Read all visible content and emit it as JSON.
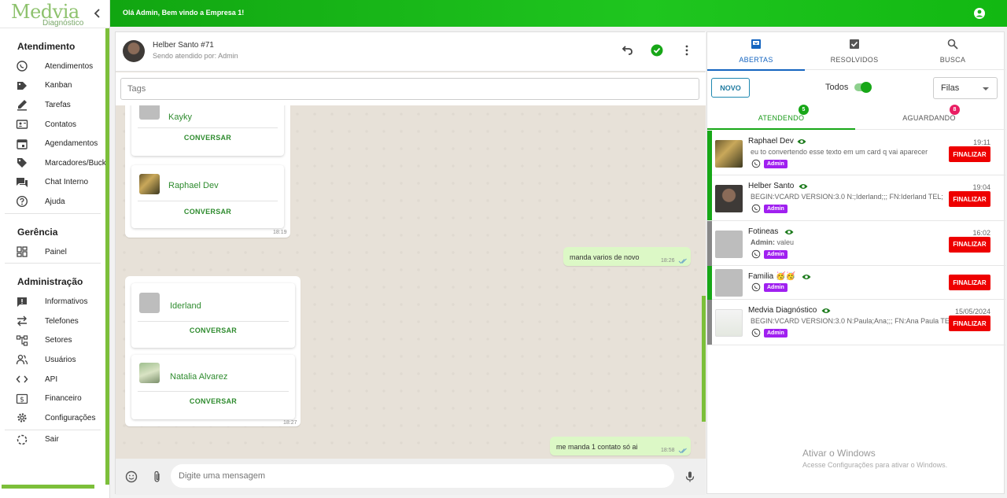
{
  "sidebar": {
    "logo_brand": "Medvia",
    "logo_sub": "Diagnóstico",
    "sections": {
      "atendimento": "Atendimento",
      "gerencia": "Gerência",
      "administracao": "Administração"
    },
    "items": {
      "atendimentos": "Atendimentos",
      "kanban": "Kanban",
      "tarefas": "Tarefas",
      "contatos": "Contatos",
      "agendamentos": "Agendamentos",
      "marcadores": "Marcadores/Bucket",
      "chat_interno": "Chat Interno",
      "ajuda": "Ajuda",
      "painel": "Painel",
      "informativos": "Informativos",
      "telefones": "Telefones",
      "setores": "Setores",
      "usuarios": "Usuários",
      "api": "API",
      "financeiro": "Financeiro",
      "configuracoes": "Configurações",
      "sair": "Sair"
    }
  },
  "topbar": {
    "greeting": "Olá Admin, Bem vindo a Empresa 1!"
  },
  "chat": {
    "title": "Helber Santo #71",
    "subtitle": "Sendo atendido por: Admin",
    "tags_placeholder": "Tags",
    "composer_placeholder": "Digite uma mensagem",
    "cards": {
      "kayky": {
        "name": "Kayky",
        "button": "CONVERSAR"
      },
      "raphael": {
        "name": "Raphael Dev",
        "button": "CONVERSAR"
      },
      "iderland": {
        "name": "Iderland",
        "button": "CONVERSAR"
      },
      "natalia": {
        "name": "Natalia Alvarez",
        "button": "CONVERSAR"
      }
    },
    "times": {
      "group1": "18:19",
      "out1": "18:26",
      "group2": "18:27",
      "out2": "18:58"
    },
    "outgoing": {
      "m1": "manda varios de novo",
      "m2": "me manda 1 contato só ai"
    }
  },
  "tickets_panel": {
    "tabs": {
      "abertas": "ABERTAS",
      "resolvidos": "RESOLVIDOS",
      "busca": "BUSCA"
    },
    "novo": "NOVO",
    "todos": "Todos",
    "filas": "Filas",
    "sub_tabs": {
      "atendendo": "ATENDENDO",
      "atendendo_count": "5",
      "aguardando": "AGUARDANDO",
      "aguardando_count": "8"
    },
    "finalizar": "FINALIZAR",
    "list": [
      {
        "name": "Raphael Dev",
        "time": "19:11",
        "message": "eu to convertendo esse texto em um card q vai aparecer",
        "queue": "Admin",
        "side_color": "#17a717"
      },
      {
        "name": "Helber Santo",
        "time": "19:04",
        "message": "BEGIN:VCARD VERSION:3.0 N:;Iderland;;; FN:Iderland TEL;",
        "queue": "Admin",
        "side_color": "#17a717"
      },
      {
        "name": "Fotineas",
        "time": "16:02",
        "message_prefix": "Admin:",
        "message": "valeu",
        "queue": "Admin",
        "side_color": "#888888"
      },
      {
        "name": "Familia 🥳🥳",
        "time": "",
        "message": "",
        "queue": "Admin",
        "side_color": "#17a717"
      },
      {
        "name": "Medvia Diagnóstico",
        "time": "15/05/2024",
        "message": "BEGIN:VCARD VERSION:3.0 N:Paula;Ana;;; FN:Ana Paula TEL;",
        "queue": "Admin",
        "side_color": "#888888"
      }
    ],
    "windows": {
      "line1": "Ativar o Windows",
      "line2": "Acesse Configurações para ativar o Windows."
    }
  },
  "colors": {
    "brand_green": "#17a717",
    "accent_blue": "#1565c0",
    "finalize_red": "#e00000",
    "queue_purple": "#a020f0"
  }
}
